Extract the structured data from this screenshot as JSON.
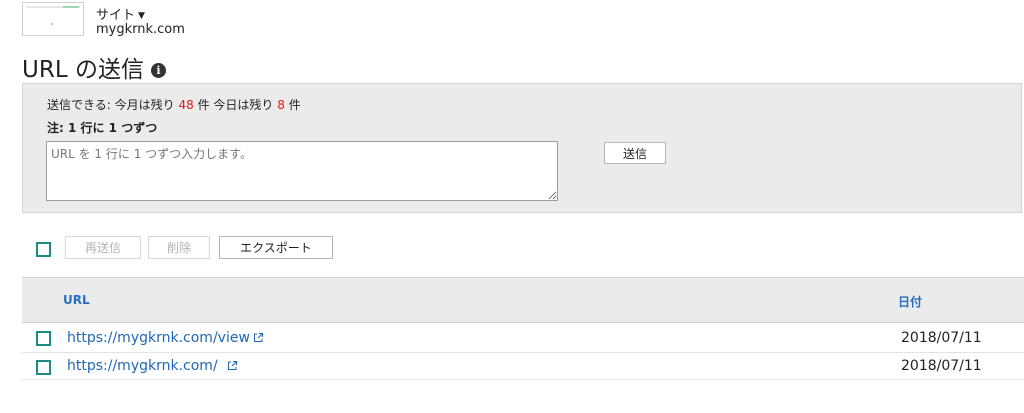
{
  "site": {
    "label": "サイト",
    "domain": "mygkrnk.com"
  },
  "page": {
    "title": "URL の送信"
  },
  "submit_panel": {
    "quota_prefix": "送信できる: 今月は残り",
    "month_remaining": "48",
    "unit1": "件 今日は残り",
    "day_remaining": "8",
    "unit2": "件",
    "note": "注: 1 行に 1 つずつ",
    "placeholder": "URL を 1 行に 1 つずつ入力します。",
    "submit_label": "送信"
  },
  "actions": {
    "resend_label": "再送信",
    "delete_label": "削除",
    "export_label": "エクスポート"
  },
  "table": {
    "col_url": "URL",
    "col_date": "日付",
    "rows": [
      {
        "url": "https://mygkrnk.com/view",
        "date": "2018/07/11"
      },
      {
        "url": "https://mygkrnk.com/",
        "date": "2018/07/11"
      }
    ]
  },
  "colors": {
    "accent": "#1d8a83",
    "link": "#1f67b4",
    "header_link": "#2a6ebb",
    "count_red": "#e01b1b",
    "panel_bg": "#ebebeb"
  },
  "icons": {
    "site_dropdown": "caret-down-icon",
    "title_info": "info-icon",
    "external_link": "external-link-icon"
  }
}
